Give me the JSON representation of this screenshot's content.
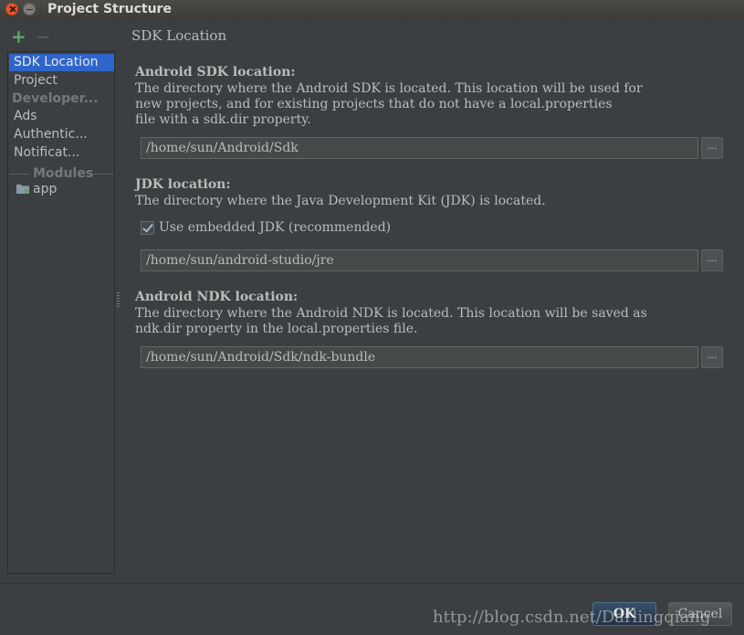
{
  "window": {
    "title": "Project Structure"
  },
  "toolbar": {
    "add_icon": "plus-icon",
    "remove_icon": "minus-icon"
  },
  "sidebar": {
    "items": [
      {
        "label": "SDK Location"
      },
      {
        "label": "Project"
      },
      {
        "label": "Developer..."
      },
      {
        "label": "Ads"
      },
      {
        "label": "Authentic..."
      },
      {
        "label": "Notificat..."
      }
    ],
    "modules_label": "Modules",
    "module_item": "app"
  },
  "main": {
    "section_title": "SDK Location",
    "android_sdk": {
      "label": "Android SDK location:",
      "desc": "The directory where the Android SDK is located. This location will be used for\nnew projects, and for existing projects that do not have a local.properties\nfile with a sdk.dir property.",
      "path": "/home/sun/Android/Sdk",
      "browse": "..."
    },
    "jdk": {
      "label": "JDK location:",
      "desc": "The directory where the Java Development Kit (JDK) is located.",
      "checkbox_label": "Use embedded JDK (recommended)",
      "checked": true,
      "path": "/home/sun/android-studio/jre",
      "browse": "..."
    },
    "android_ndk": {
      "label": "Android NDK location:",
      "desc": "The directory where the Android NDK is located. This location will be saved as\nndk.dir property in the local.properties file.",
      "path": "/home/sun/Android/Sdk/ndk-bundle",
      "browse": "..."
    }
  },
  "footer": {
    "ok": "OK",
    "cancel": "Cancel"
  },
  "watermark": "http://blog.csdn.net/Darlingqiang",
  "colors": {
    "background": "#3c3f41",
    "selection": "#2f65ca",
    "add_green": "#59a869",
    "close_orange": "#e9582a"
  }
}
